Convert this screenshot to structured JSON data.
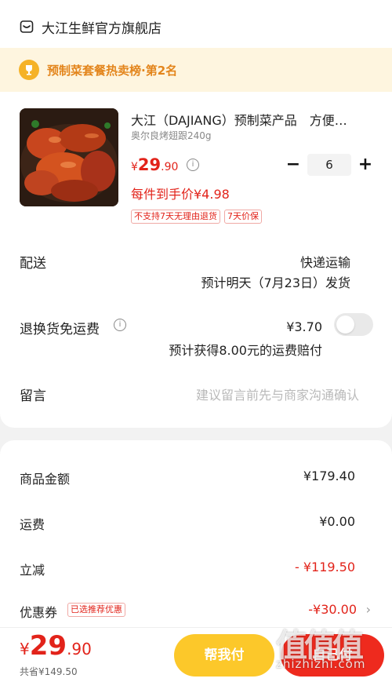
{
  "shop": {
    "name": "大江生鲜官方旗舰店",
    "icon": "shop-icon"
  },
  "rank": {
    "text": "预制菜套餐热卖榜·第2名",
    "icon": "trophy-icon",
    "color": "#e3851c"
  },
  "product": {
    "title": "大江（DAJIANG）预制菜产品　方便…",
    "spec": "奥尔良烤翅跟240g",
    "price": {
      "currency": "¥",
      "integer": "29",
      "decimal": ".90"
    },
    "quantity": "6",
    "minus": "−",
    "plus": "+",
    "unit_price": "每件到手价¥4.98",
    "tags": [
      "不支持7天无理由退货",
      "7天价保"
    ]
  },
  "shipping": {
    "label": "配送",
    "method": "快递运输",
    "estimate": "预计明天（7月23日）发货"
  },
  "return_insurance": {
    "label": "退换货免运费",
    "price": "¥3.70",
    "enabled": false,
    "estimate": "预计获得8.00元的运费赔付"
  },
  "note": {
    "label": "留言",
    "placeholder": "建议留言前先与商家沟通确认"
  },
  "summary": {
    "goods_label": "商品金额",
    "goods_value": "¥179.40",
    "freight_label": "运费",
    "freight_value": "¥0.00",
    "discount_label": "立减",
    "discount_value": "- ¥119.50",
    "coupon_label": "优惠券",
    "coupon_badge": "已选推荐优惠",
    "coupon_value": "-¥30.00",
    "chevron": "›"
  },
  "bottom": {
    "total": {
      "currency": "¥",
      "integer": "29",
      "decimal": ".90"
    },
    "saved": "共省¥149.50",
    "help_button": "帮我付",
    "pay_button": "自己付"
  },
  "watermark": {
    "logo": "值值值",
    "text": "zhizhizhi.com"
  },
  "colors": {
    "price_red": "#e2231a",
    "pay_red": "#ee2a1e",
    "help_yellow": "#fcc82a",
    "rank_bg": "#fef5df"
  }
}
